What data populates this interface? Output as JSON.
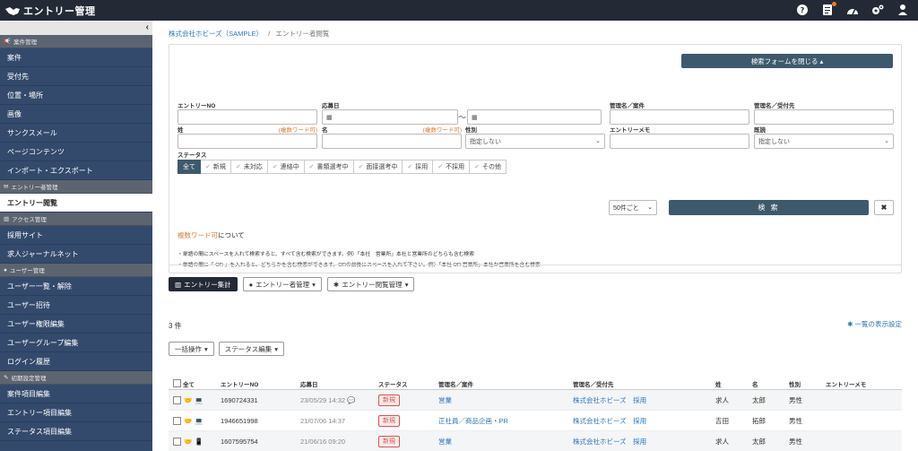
{
  "app": {
    "title": "エントリー管理"
  },
  "sidebar": {
    "sections": [
      {
        "label": "案件管理",
        "items": [
          "案件",
          "受付先",
          "位置・場所",
          "画像",
          "サンクスメール",
          "ページコンテンツ",
          "インポート・エクスポート"
        ]
      },
      {
        "label": "エントリー者管理",
        "items": [
          "エントリー閲覧"
        ]
      },
      {
        "label": "アクセス管理",
        "items": [
          "採用サイト",
          "求人ジャーナルネット"
        ]
      },
      {
        "label": "ユーザー管理",
        "items": [
          "ユーザー一覧・解除",
          "ユーザー招待",
          "ユーザー権限編集",
          "ユーザーグループ編集",
          "ログイン履歴"
        ]
      },
      {
        "label": "初期設定管理",
        "items": [
          "案件項目編集",
          "エントリー項目編集",
          "ステータス項目編集"
        ]
      }
    ],
    "active": "エントリー閲覧"
  },
  "breadcrumb": {
    "company": "株式会社ホビーズ（SAMPLE）",
    "sep": "/",
    "current": "エントリー者閲覧"
  },
  "search": {
    "close_label": "検索フォームを閉じる ▴",
    "fields": {
      "entry_no": "エントリーNO",
      "apply_date": "応募日",
      "manager_case": "管理名／案件",
      "manager_receiver": "管理名／受付先",
      "last_name": "姓",
      "first_name": "名",
      "multi_word": "(複数ワード可)",
      "gender": "性別",
      "gender_value": "指定しない",
      "entry_memo": "エントリーメモ",
      "read": "既読",
      "read_value": "指定しない",
      "tilde": "〜"
    },
    "status_label": "ステータス",
    "statuses": [
      "全て",
      "新規",
      "未対応",
      "連絡中",
      "書類選考中",
      "面接選考中",
      "採用",
      "不採用",
      "その他"
    ],
    "per_page": "50件ごと",
    "search_label": "検 索",
    "clear_label": "✖",
    "help_title_orange": "複数ワード可",
    "help_title_rest": "について",
    "help_line1": "・単語の間にスペースを入れて検索すると、すべて含む検索ができます。例）「本社　営業所」本社と営業所のどちらも含む検索",
    "help_line2": "・単語の間に「 OR 」を入れると、どちらかを含む検索ができます。ORの前後にスペースを入れて下さい。例）「本社 OR 営業所」本社か営業所を含む検索"
  },
  "toolbar": {
    "entry_stats": "エントリー集計",
    "entry_manage": "エントリー者管理",
    "entry_view_manage": "エントリー閲覧管理",
    "bulk_ops": "一括操作",
    "status_edit": "ステータス編集",
    "list_settings": "一覧の表示設定"
  },
  "count": "3 件",
  "table": {
    "headers": [
      "全て",
      "エントリーNO",
      "応募日",
      "ステータス",
      "管理名／案件",
      "管理名／受付先",
      "姓",
      "名",
      "性別",
      "エントリーメモ"
    ],
    "rows": [
      {
        "entry_no": "1690724331",
        "date": "23/05/29 14:32",
        "status": "新規",
        "case": "営業",
        "receiver": "株式会社ホビーズ　採用",
        "last": "求人",
        "first": "太郎",
        "gender": "男性",
        "device": "pc"
      },
      {
        "entry_no": "1946651998",
        "date": "21/07/06 14:37",
        "status": "新規",
        "case": "正社員／商品企画・PR",
        "receiver": "株式会社ホビーズ　採用",
        "last": "吉田",
        "first": "拓郎",
        "gender": "男性",
        "device": "pc"
      },
      {
        "entry_no": "1607595754",
        "date": "21/06/16 09:20",
        "status": "新規",
        "case": "営業",
        "receiver": "株式会社ホビーズ　採用",
        "last": "求人",
        "first": "太郎",
        "gender": "男性",
        "device": "mobile"
      }
    ]
  },
  "colors": {
    "topbar": "#232a36",
    "sidebar": "#334a6c",
    "primary": "#3d5a6c",
    "link": "#2d74b8",
    "badge": "#d9534f"
  }
}
